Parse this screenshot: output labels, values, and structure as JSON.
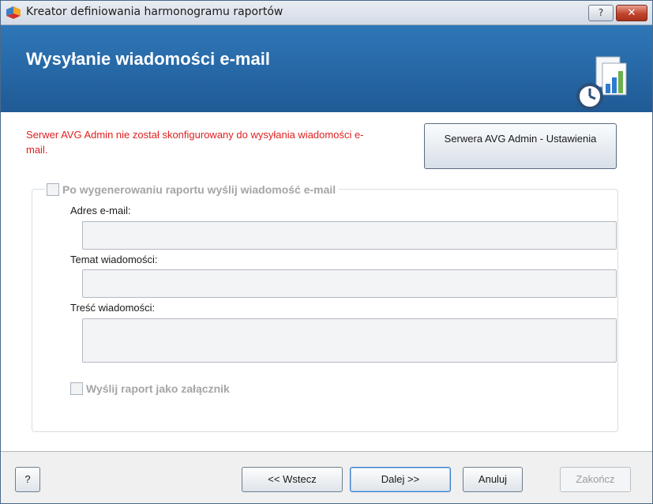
{
  "window": {
    "title": "Kreator definiowania harmonogramu raportów",
    "help_label": "?",
    "close_label": "✕"
  },
  "header": {
    "title": "Wysyłanie wiadomości e-mail",
    "icon": "report-schedule-icon"
  },
  "warning": {
    "text": "Serwer AVG Admin nie został skonfigurowany do wysyłania wiadomości e-mail.",
    "color": "#e02020"
  },
  "settings_button": {
    "label": "Serwera AVG Admin - Ustawienia"
  },
  "email_group": {
    "checkbox_label": "Po wygenerowaniu raportu wyślij wiadomość e-mail",
    "checked": false,
    "address_label": "Adres e-mail:",
    "address_value": "",
    "subject_label": "Temat wiadomości:",
    "subject_value": "",
    "body_label": "Treść wiadomości:",
    "body_value": "",
    "attachment_label": "Wyślij raport jako załącznik",
    "attachment_checked": false
  },
  "footer": {
    "help_label": "?",
    "back_label": "<< Wstecz",
    "next_label": "Dalej >>",
    "cancel_label": "Anuluj",
    "finish_label": "Zakończ"
  },
  "colors": {
    "header_blue": "#2a6aa8",
    "warning_red": "#e02020",
    "disabled_text": "#a5a5a5"
  }
}
